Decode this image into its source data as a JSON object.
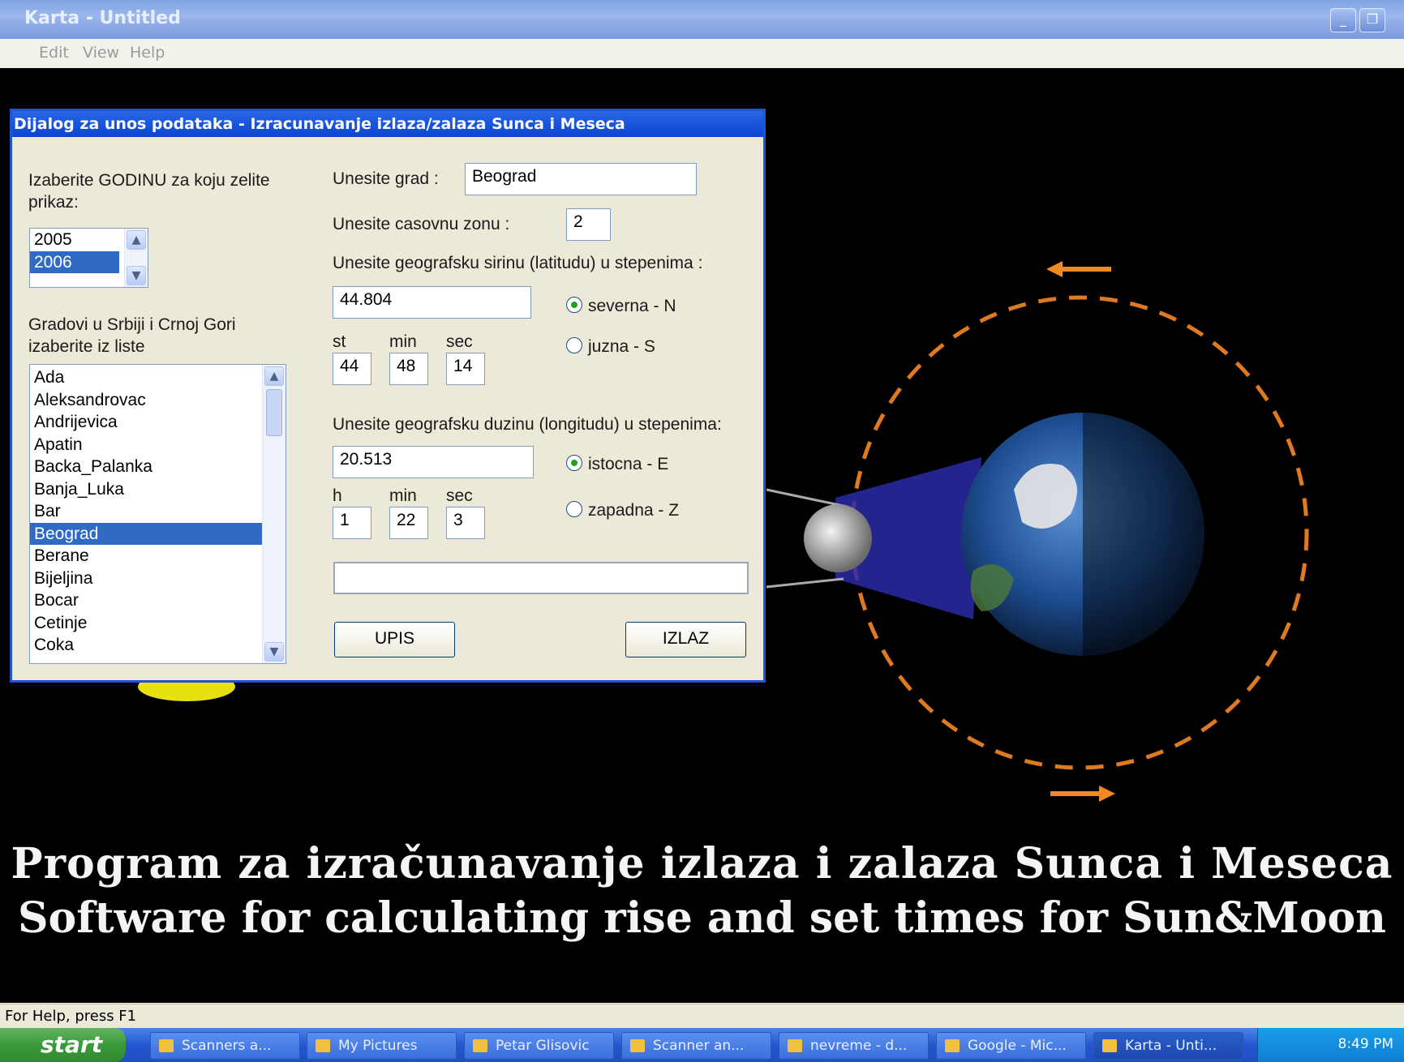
{
  "window": {
    "title": "Karta - Untitled",
    "menu": [
      "Edit",
      "View",
      "Help"
    ],
    "status": "For Help, press F1"
  },
  "captions": {
    "line1": "Program za izračunavanje izlaza i zalaza Sunca i Meseca",
    "line2": "Software for calculating rise and set times for Sun&Moon"
  },
  "dialog": {
    "title": "Dijalog za unos podataka - Izracunavanje izlaza/zalaza Sunca i Meseca",
    "year_label": "Izaberite GODINU za koju zelite prikaz:",
    "years": [
      "2005",
      "2006"
    ],
    "year_selected": "2006",
    "city_list_label": "Gradovi u Srbiji i Crnoj Gori izaberite iz liste",
    "cities": [
      "Ada",
      "Aleksandrovac",
      "Andrijevica",
      "Apatin",
      "Backa_Palanka",
      "Banja_Luka",
      "Bar",
      "Beograd",
      "Berane",
      "Bijeljina",
      "Bocar",
      "Cetinje",
      "Coka"
    ],
    "city_selected": "Beograd",
    "city_label": "Unesite grad :",
    "city_value": "Beograd",
    "tz_label": "Unesite casovnu zonu :",
    "tz_value": "2",
    "lat_label": "Unesite geografsku sirinu (latitudu) u stepenima :",
    "lat_value": "44.804",
    "lat_n": "severna - N",
    "lat_s": "juzna - S",
    "lat_sub": {
      "st": "st",
      "min": "min",
      "sec": "sec",
      "st_val": "44",
      "min_val": "48",
      "sec_val": "14"
    },
    "lon_label": "Unesite geografsku duzinu (longitudu) u stepenima:",
    "lon_value": "20.513",
    "lon_e": "istocna - E",
    "lon_w": "zapadna - Z",
    "lon_sub": {
      "h": "h",
      "min": "min",
      "sec": "sec",
      "h_val": "1",
      "min_val": "22",
      "sec_val": "3"
    },
    "result_value": "",
    "upis": "UPIS",
    "izlaz": "IZLAZ"
  },
  "taskbar": {
    "start": "start",
    "tasks": [
      "Scanners a...",
      "My Pictures",
      "Petar Glisovic",
      "Scanner an...",
      "nevreme - d...",
      "Google - Mic...",
      "Karta - Unti..."
    ],
    "clock": "8:49 PM"
  },
  "colors": {
    "accent": "#0a46d0",
    "selection": "#316ac5",
    "orbit": "#e07a20"
  }
}
